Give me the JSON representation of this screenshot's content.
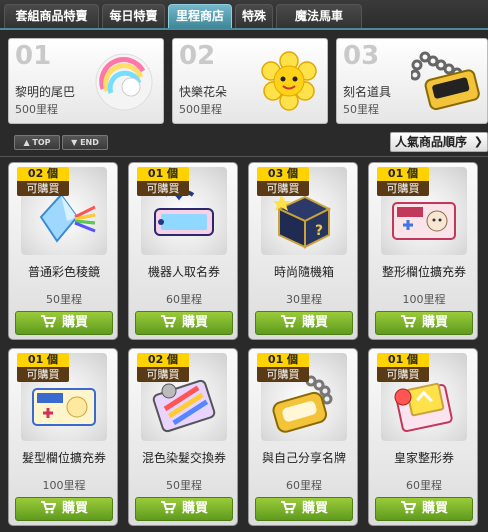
{
  "tabs": [
    {
      "label": "套組商品特賣",
      "active": false
    },
    {
      "label": "每日特賣",
      "active": false
    },
    {
      "label": "里程商店",
      "active": true
    },
    {
      "label": "特殊",
      "active": false
    },
    {
      "label": "魔法馬車",
      "active": false
    }
  ],
  "featured": [
    {
      "number": "01",
      "name": "黎明的尾巴",
      "price": "500里程",
      "icon": "rainbow-tail-icon"
    },
    {
      "number": "02",
      "name": "快樂花朵",
      "price": "500里程",
      "icon": "happy-flower-icon"
    },
    {
      "number": "03",
      "name": "刻名道具",
      "price": "50里程",
      "icon": "name-tag-icon"
    }
  ],
  "sort": {
    "top_label": "TOP",
    "end_label": "END",
    "order_label": "人氣商品順序"
  },
  "items": [
    {
      "count": "02 個",
      "can_buy": "可購買",
      "name": "普通彩色稜鏡",
      "price": "50里程",
      "buy_label": "購買",
      "icon": "prism-icon"
    },
    {
      "count": "01 個",
      "can_buy": "可購買",
      "name": "機器人取名券",
      "price": "60里程",
      "buy_label": "購買",
      "icon": "name-ticket-icon"
    },
    {
      "count": "03 個",
      "can_buy": "可購買",
      "name": "時尚隨機箱",
      "price": "30里程",
      "buy_label": "購買",
      "icon": "random-box-icon"
    },
    {
      "count": "01 個",
      "can_buy": "可購買",
      "name": "整形欄位擴充券",
      "price": "100里程",
      "buy_label": "購買",
      "icon": "slot-ticket-icon"
    },
    {
      "count": "01 個",
      "can_buy": "可購買",
      "name": "髮型欄位擴充券",
      "price": "100里程",
      "buy_label": "購買",
      "icon": "hair-slot-ticket-icon"
    },
    {
      "count": "02 個",
      "can_buy": "可購買",
      "name": "混色染髮交換券",
      "price": "50里程",
      "buy_label": "購買",
      "icon": "hair-dye-coupon-icon"
    },
    {
      "count": "01 個",
      "can_buy": "可購買",
      "name": "與自己分享名牌",
      "price": "60里程",
      "buy_label": "購買",
      "icon": "nametag-share-icon"
    },
    {
      "count": "01 個",
      "can_buy": "可購買",
      "name": "皇家整形券",
      "price": "60里程",
      "buy_label": "購買",
      "icon": "royal-coupon-icon"
    }
  ]
}
